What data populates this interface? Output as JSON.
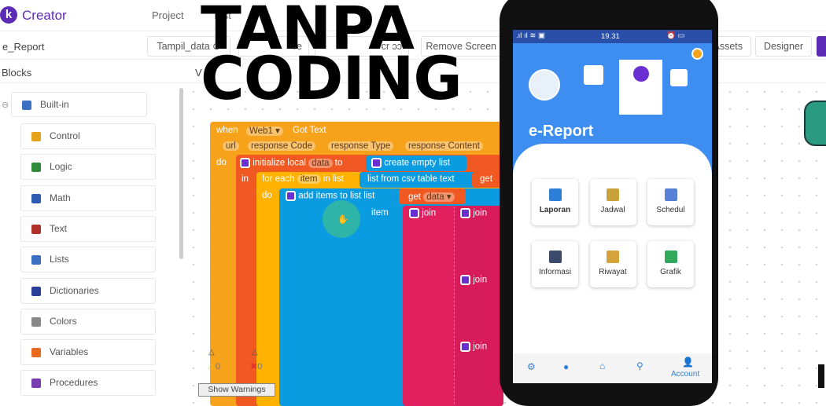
{
  "app": {
    "brand": "Creator",
    "logo_letter": "k",
    "menu": [
      "Project",
      "Test"
    ]
  },
  "toolbar": {
    "project_name": "e_Report",
    "screen_select": "Tampil_data ⊙",
    "btn2": "re",
    "btn3": "cr  ɔɔ",
    "remove_screen": "Remove Screen (",
    "assets": "Assets",
    "designer": "Designer"
  },
  "panel": {
    "blocks_title": "Blocks",
    "viewer_title": "V"
  },
  "sidebar": {
    "root": "Built-in",
    "items": [
      {
        "label": "Control",
        "color": "#e6a21a"
      },
      {
        "label": "Logic",
        "color": "#2f8a3a"
      },
      {
        "label": "Math",
        "color": "#2d5db3"
      },
      {
        "label": "Text",
        "color": "#b0302a"
      },
      {
        "label": "Lists",
        "color": "#3a6fc2"
      },
      {
        "label": "Dictionaries",
        "color": "#2b3f9a"
      },
      {
        "label": "Colors",
        "color": "#888888"
      },
      {
        "label": "Variables",
        "color": "#e86a1e"
      },
      {
        "label": "Procedures",
        "color": "#7a3ab0"
      }
    ]
  },
  "blocks": {
    "when": "when",
    "component": "Web1 ▾",
    "event": "Got Text",
    "params": [
      "url",
      "response Code",
      "response Type",
      "response Content"
    ],
    "do": "do",
    "init": "initialize local",
    "var": "data",
    "to": "to",
    "create_list": "create empty list",
    "in": "in",
    "for_each": "for each",
    "item_var": "item",
    "in_list": "in list",
    "csv": "list from csv table  text",
    "get": "get",
    "do2": "do",
    "add_items": "add items to list  list",
    "get_data": "get",
    "data_pill": "data ▾",
    "item_label": "item",
    "join": "join"
  },
  "warnings": {
    "warning_count": "0",
    "error_count": "0",
    "show_warnings": "Show Warnings"
  },
  "overlay": {
    "line1": "TANPA",
    "line2": "CODING"
  },
  "phone": {
    "status_time": "19.31",
    "app_title": "e-Report",
    "menu": [
      {
        "label": "Laporan",
        "color": "#2f7fd6"
      },
      {
        "label": "Jadwal",
        "color": "#c9a23a"
      },
      {
        "label": "Schedul",
        "color": "#5a7fd6"
      },
      {
        "label": "Informasi",
        "color": "#3a4a6a"
      },
      {
        "label": "Riwayat",
        "color": "#d6a23a"
      },
      {
        "label": "Grafik",
        "color": "#2faa5a"
      }
    ],
    "nav": {
      "account": "Account"
    }
  },
  "colors": {
    "accent": "#5b2bb5",
    "event": "#f7a21b",
    "local": "#f05a22",
    "loop": "#ffb300",
    "list": "#0a9be0",
    "text": "#e0205f",
    "phone_blue": "#3d8ef0"
  }
}
